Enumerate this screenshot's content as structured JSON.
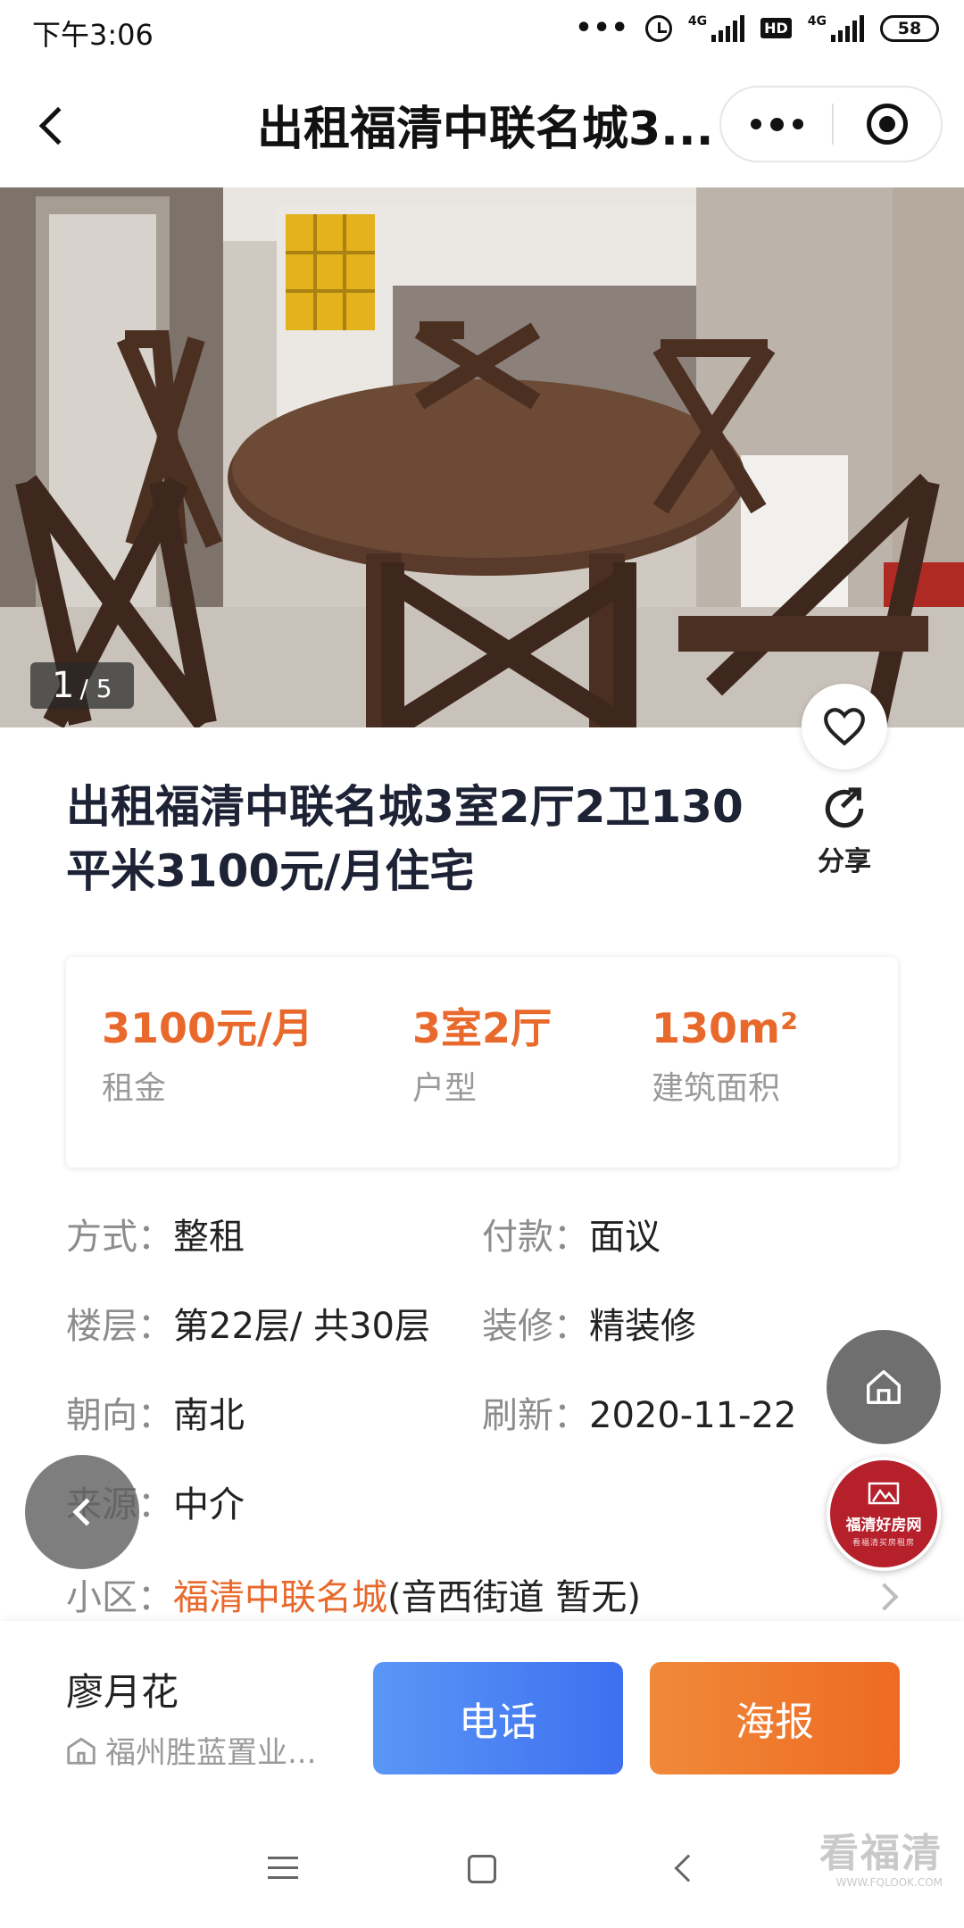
{
  "status_bar": {
    "time": "下午3:06",
    "network_label": "4G",
    "hd_label": "HD",
    "battery": "58"
  },
  "nav": {
    "title": "出租福清中联名城3..."
  },
  "gallery": {
    "current": "1",
    "total": "/ 5"
  },
  "listing": {
    "title": "出租福清中联名城3室2厅2卫130平米3100元/月住宅",
    "share_label": "分享"
  },
  "summary": {
    "rent_value": "3100元/月",
    "rent_label": "租金",
    "layout_value": "3室2厅",
    "layout_label": "户型",
    "area_value": "130m²",
    "area_label": "建筑面积"
  },
  "details": {
    "method_key": "方式：",
    "method_value": "整租",
    "payment_key": "付款：",
    "payment_value": "面议",
    "floor_key": "楼层：",
    "floor_value": "第22层/ 共30层",
    "decoration_key": "装修：",
    "decoration_value": "精装修",
    "orientation_key": "朝向：",
    "orientation_value": "南北",
    "refresh_key": "刷新：",
    "refresh_value": "2020-11-22",
    "source_key": "来源：",
    "source_value": "中介",
    "community_key": "小区：",
    "community_name": "福清中联名城",
    "community_extra": "(音西街道 暂无)"
  },
  "float": {
    "logo_text": "福清好房网",
    "logo_sub": "看福清买房租房"
  },
  "bottom_bar": {
    "agent_name": "廖月花",
    "agent_company": "福州胜蓝置业...",
    "phone_button": "电话",
    "poster_button": "海报"
  },
  "watermark": {
    "main": "看福清",
    "sub": "WWW.FQLOOK.COM"
  },
  "colors": {
    "accent_orange": "#e8692b",
    "phone_blue": "#4a83f3",
    "logo_red": "#b5202b"
  }
}
